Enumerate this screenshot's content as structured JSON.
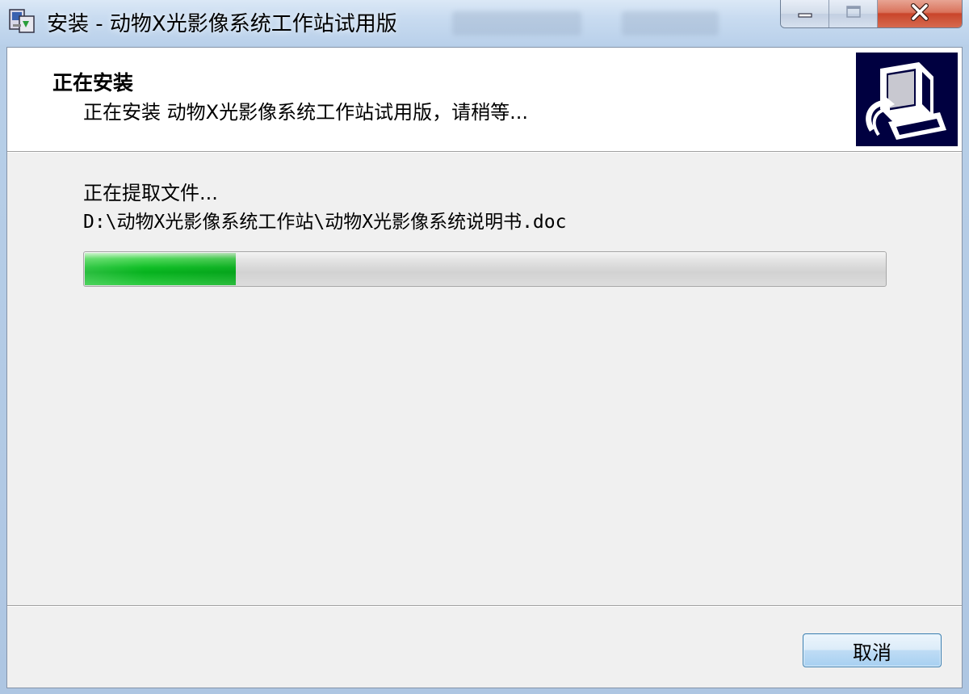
{
  "window": {
    "title": "安装 - 动物X光影像系统工作站试用版",
    "controls": {
      "minimize": "minimize",
      "maximize": "maximize",
      "close": "close"
    }
  },
  "header": {
    "title": "正在安装",
    "subtitle": "正在安装 动物X光影像系统工作站试用版，请稍等..."
  },
  "main": {
    "status": "正在提取文件...",
    "current_file": "D:\\动物X光影像系统工作站\\动物X光影像系统说明书.doc",
    "progress_fraction": 0.19
  },
  "footer": {
    "cancel_label": "取消"
  },
  "colors": {
    "progress_green": "#11bf27",
    "logo_background": "#000040",
    "close_button_red": "#c9452b"
  },
  "icons": [
    "installer-app-icon",
    "minimize-icon",
    "maximize-icon",
    "close-icon",
    "computer-install-logo"
  ]
}
